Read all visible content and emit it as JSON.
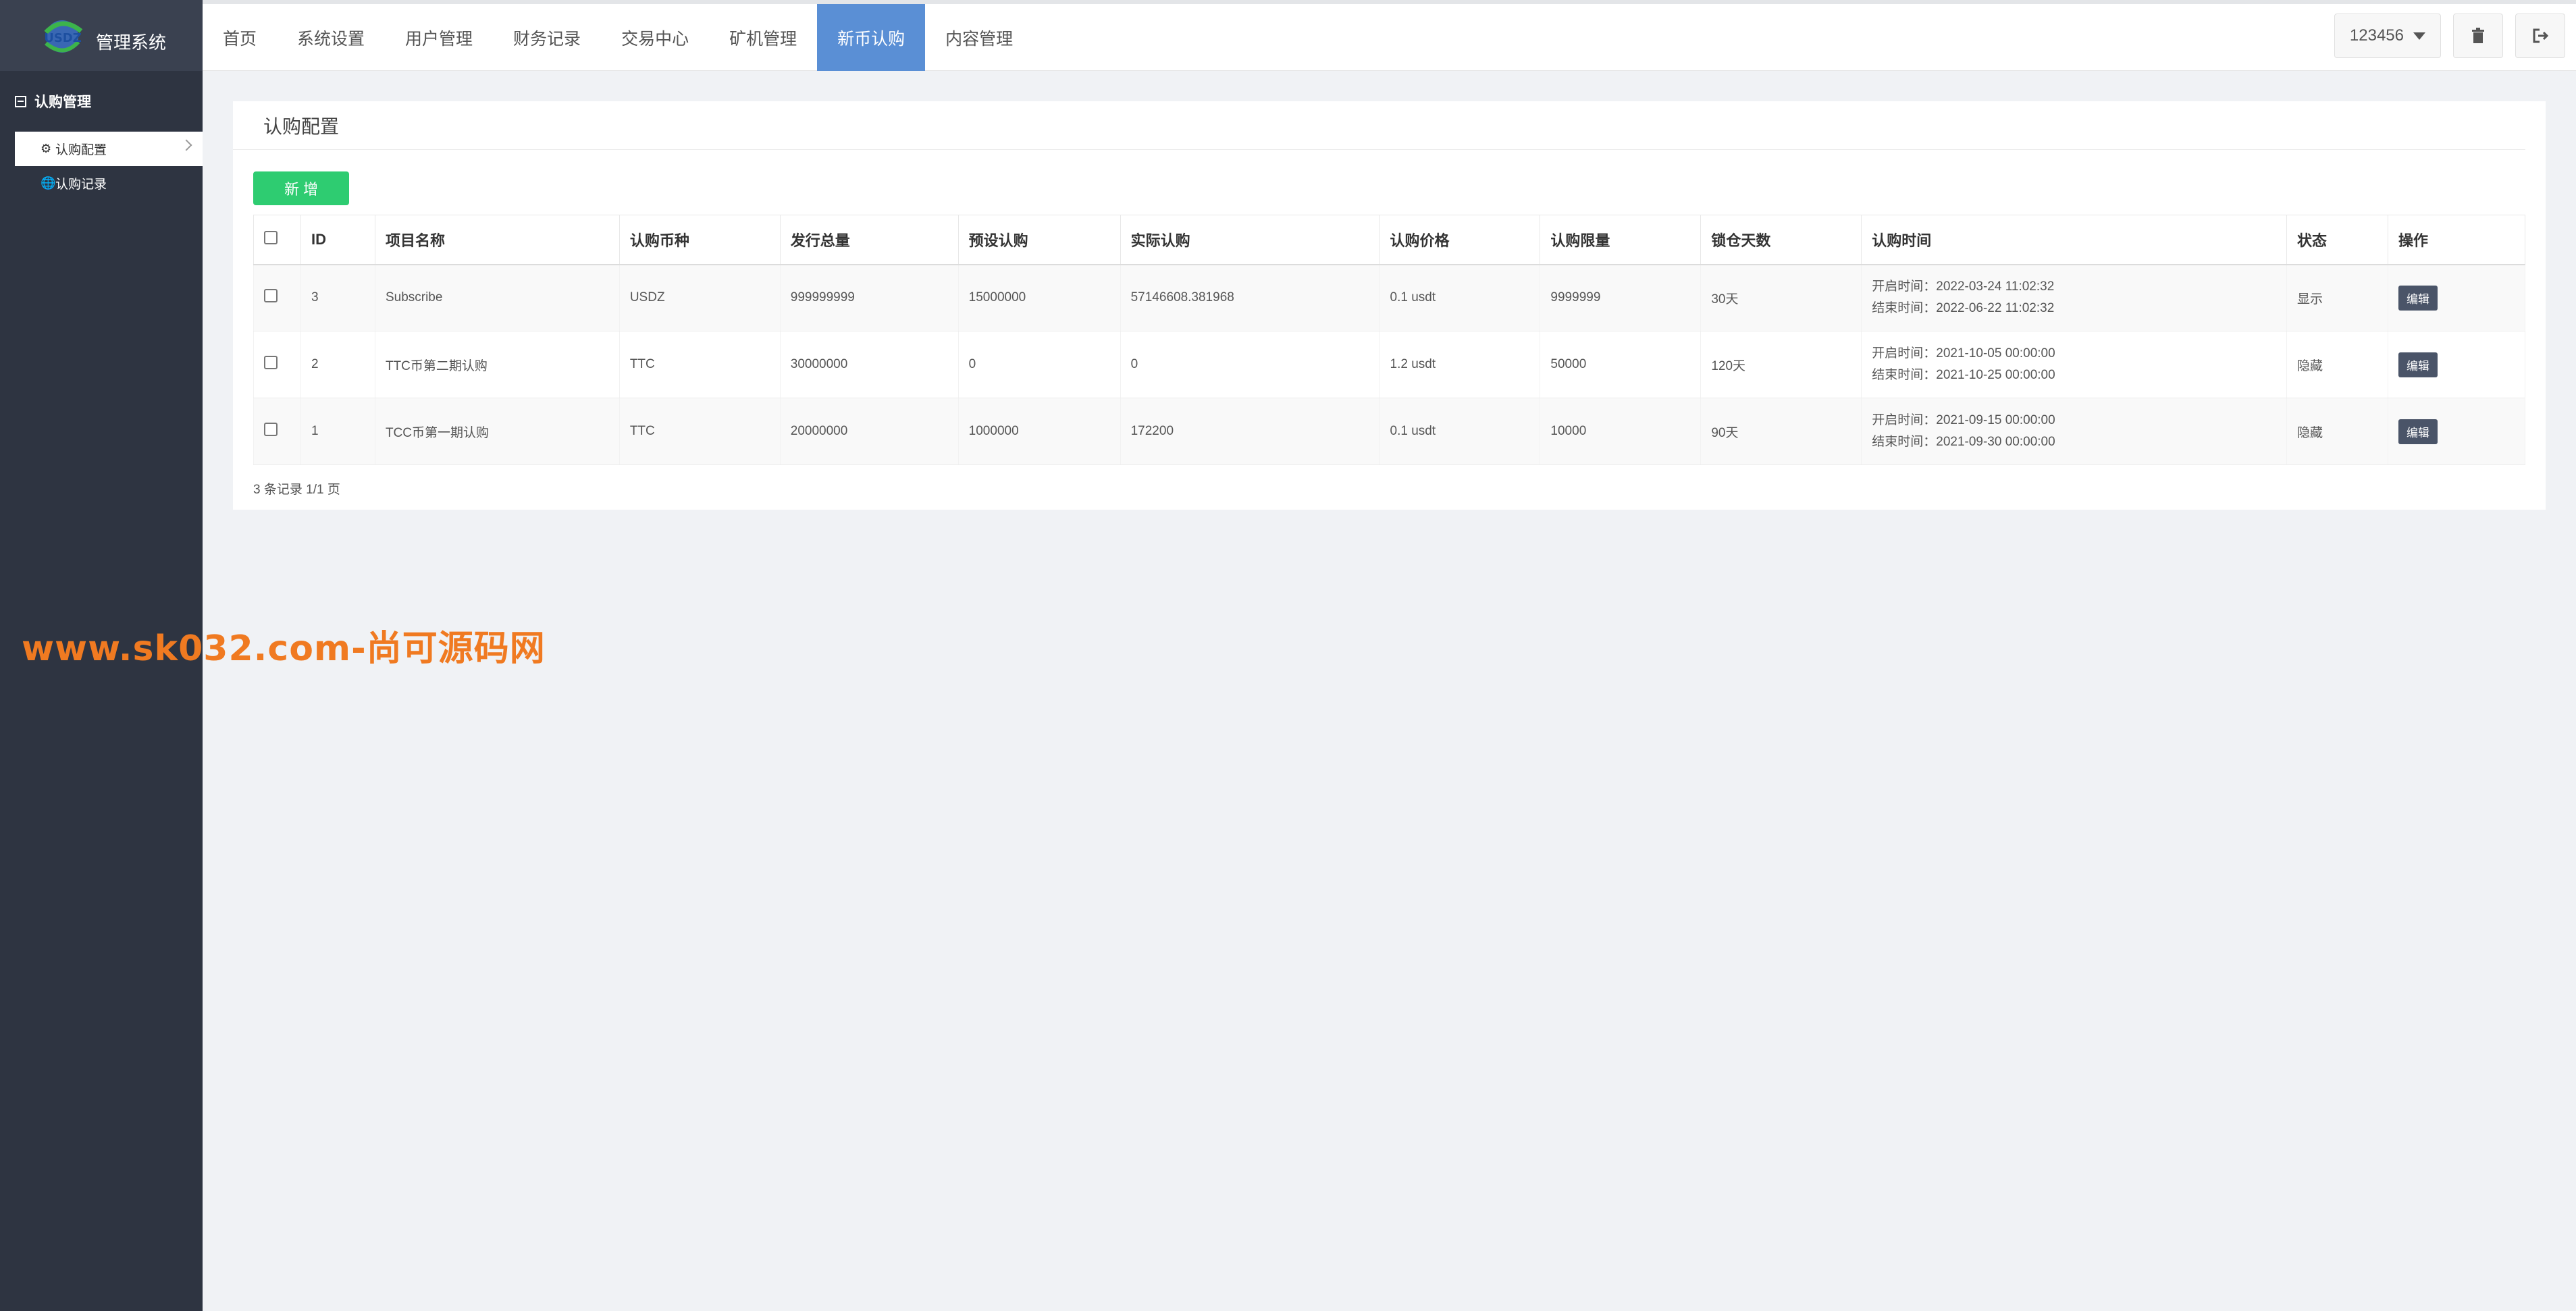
{
  "sidebar": {
    "logo_text": "管理系统",
    "logo_mark_text": "USDZ",
    "group_label": "认购管理",
    "items": [
      {
        "label": "认购配置",
        "icon": "gear-icon",
        "active": true
      },
      {
        "label": "认购记录",
        "icon": "globe-icon",
        "active": false
      }
    ]
  },
  "header": {
    "tabs": [
      {
        "label": "首页"
      },
      {
        "label": "系统设置"
      },
      {
        "label": "用户管理"
      },
      {
        "label": "财务记录"
      },
      {
        "label": "交易中心"
      },
      {
        "label": "矿机管理"
      },
      {
        "label": "新币认购",
        "active": true
      },
      {
        "label": "内容管理"
      }
    ],
    "user_label": "123456",
    "trash_icon": "trash-icon",
    "logout_icon": "logout-icon"
  },
  "panel": {
    "title": "认购配置",
    "add_label": "新 增",
    "columns": [
      "ID",
      "项目名称",
      "认购币种",
      "发行总量",
      "预设认购",
      "实际认购",
      "认购价格",
      "认购限量",
      "锁仓天数",
      "认购时间",
      "状态",
      "操作"
    ],
    "rows": [
      {
        "id": "3",
        "name": "Subscribe",
        "coin": "USDZ",
        "total": "999999999",
        "preset": "15000000",
        "actual": "57146608.381968",
        "price": "0.1 usdt",
        "limit": "9999999",
        "lock_days": "30天",
        "start": "开启时间：2022-03-24 11:02:32",
        "end": "结束时间：2022-06-22 11:02:32",
        "status": "显示",
        "action": "编辑"
      },
      {
        "id": "2",
        "name": "TTC币第二期认购",
        "coin": "TTC",
        "total": "30000000",
        "preset": "0",
        "actual": "0",
        "price": "1.2 usdt",
        "limit": "50000",
        "lock_days": "120天",
        "start": "开启时间：2021-10-05 00:00:00",
        "end": "结束时间：2021-10-25 00:00:00",
        "status": "隐藏",
        "action": "编辑"
      },
      {
        "id": "1",
        "name": "TCC币第一期认购",
        "coin": "TTC",
        "total": "20000000",
        "preset": "1000000",
        "actual": "172200",
        "price": "0.1 usdt",
        "limit": "10000",
        "lock_days": "90天",
        "start": "开启时间：2021-09-15 00:00:00",
        "end": "结束时间：2021-09-30 00:00:00",
        "status": "隐藏",
        "action": "编辑"
      }
    ],
    "footer": "3 条记录 1/1 页"
  },
  "watermark": "www.sk032.com-尚可源码网",
  "colors": {
    "sidebar_bg": "#2e3441",
    "active_tab": "#5a8fd5",
    "add_button": "#2ecc71",
    "edit_button": "#4a5468",
    "watermark": "#f07a21"
  }
}
